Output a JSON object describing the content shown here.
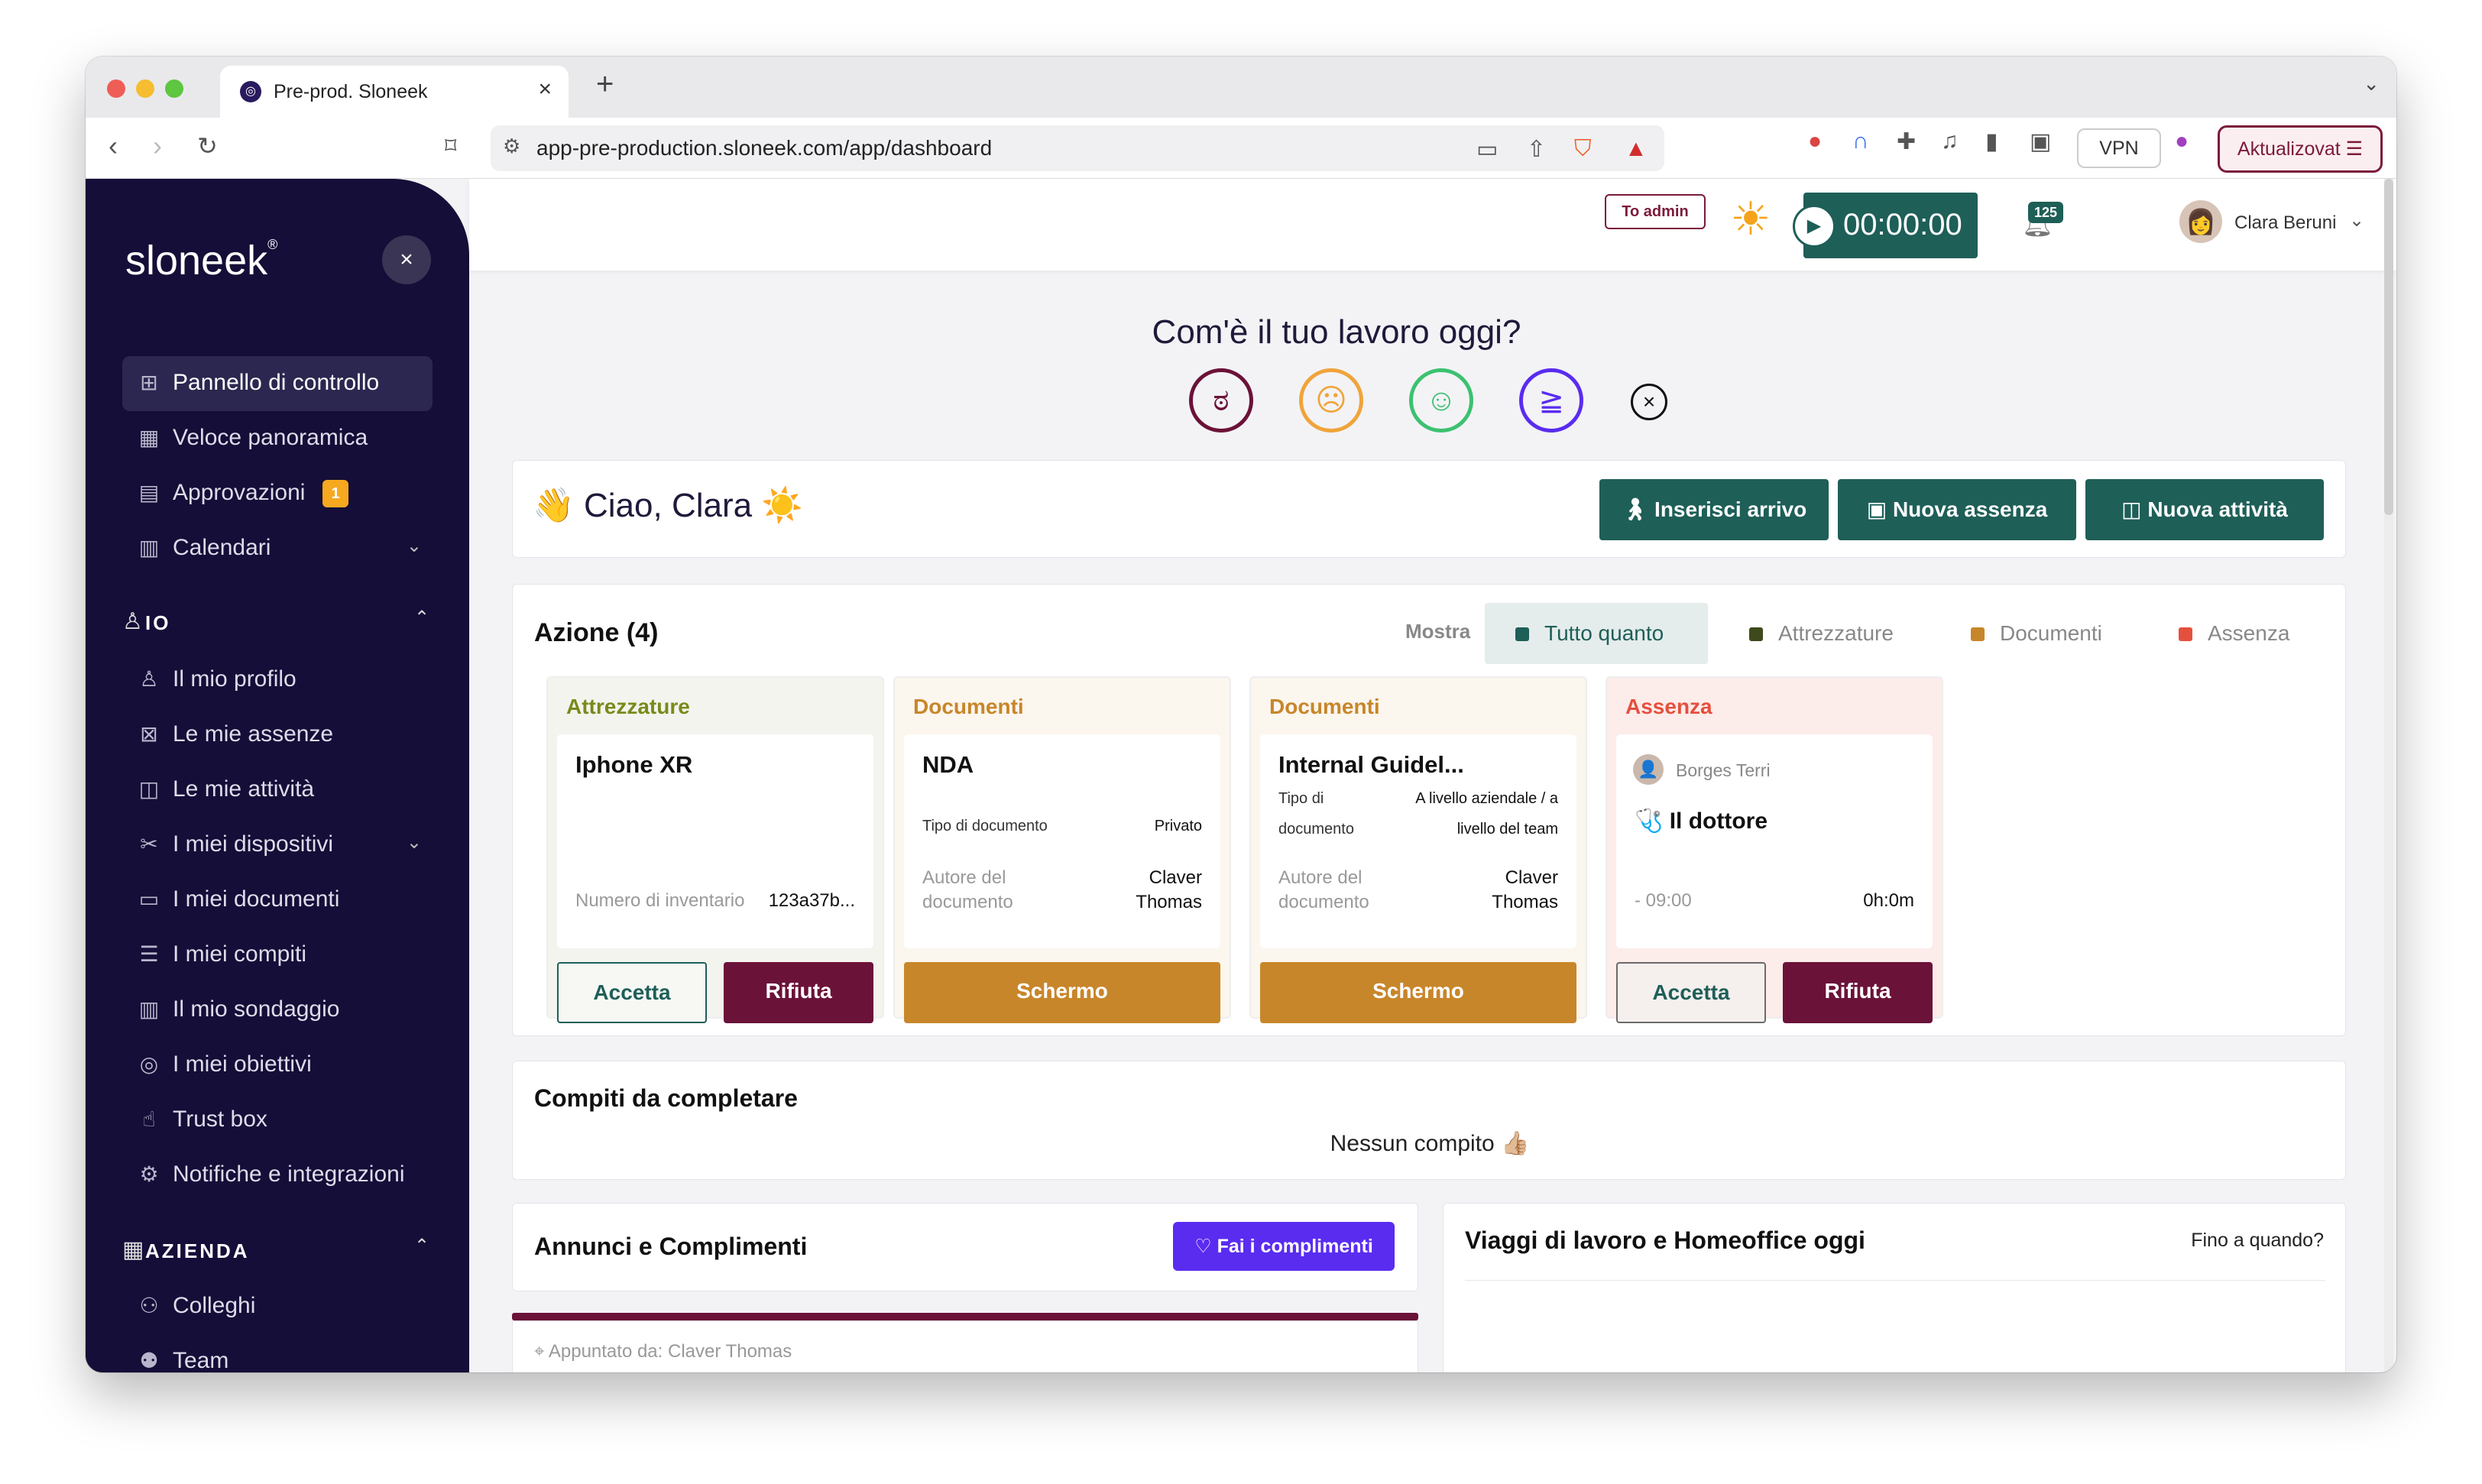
{
  "browser": {
    "tab_title": "Pre-prod. Sloneek",
    "url": "app-pre-production.sloneek.com/app/dashboard",
    "vpn_label": "VPN",
    "update_label": "Aktualizovat"
  },
  "sidebar": {
    "logo": "sloneek",
    "items_top": [
      {
        "label": "Pannello di controllo",
        "icon": "dashboard-icon",
        "active": true
      },
      {
        "label": "Veloce panoramica",
        "icon": "grid-icon"
      },
      {
        "label": "Approvazioni",
        "icon": "clipboard-icon",
        "badge": "1"
      },
      {
        "label": "Calendari",
        "icon": "calendar-icon",
        "chevron": true
      }
    ],
    "section_io": "IO",
    "items_io": [
      {
        "label": "Il mio profilo",
        "icon": "user-icon"
      },
      {
        "label": "Le mie assenze",
        "icon": "calendar-x-icon"
      },
      {
        "label": "Le mie attività",
        "icon": "book-icon"
      },
      {
        "label": "I miei dispositivi",
        "icon": "tools-icon",
        "chevron": true
      },
      {
        "label": "I miei documenti",
        "icon": "folder-icon"
      },
      {
        "label": "I miei compiti",
        "icon": "checklist-icon"
      },
      {
        "label": "Il mio sondaggio",
        "icon": "survey-icon"
      },
      {
        "label": "I miei obiettivi",
        "icon": "target-icon"
      },
      {
        "label": "Trust box",
        "icon": "hand-icon"
      },
      {
        "label": "Notifiche e integrazioni",
        "icon": "gear-icon"
      }
    ],
    "section_company": "AZIENDA",
    "items_company": [
      {
        "label": "Colleghi",
        "icon": "people-icon"
      },
      {
        "label": "Team",
        "icon": "team-icon"
      }
    ]
  },
  "topbar": {
    "to_admin": "To admin",
    "timer": "00:00:00",
    "notifications": "125",
    "user_name": "Clara Beruni"
  },
  "mood": {
    "title": "Com'è il tuo lavoro oggi?"
  },
  "greeting": {
    "text": "👋 Ciao, Clara ☀️",
    "buttons": [
      "Inserisci arrivo",
      "Nuova assenza",
      "Nuova attività"
    ]
  },
  "actions": {
    "title": "Azione (4)",
    "show_label": "Mostra",
    "filters": [
      {
        "label": "Tutto quanto",
        "color": "#1e5f58",
        "active": true
      },
      {
        "label": "Attrezzature",
        "color": "#3e4a1c"
      },
      {
        "label": "Documenti",
        "color": "#c8862a"
      },
      {
        "label": "Assenza",
        "color": "#e5503e"
      }
    ],
    "cards": [
      {
        "category": "Attrezzature",
        "name": "Iphone XR",
        "rows": [
          {
            "label": "Numero di inventario",
            "value": "123a37b..."
          }
        ],
        "accept": "Accetta",
        "reject": "Rifiuta"
      },
      {
        "category": "Documenti",
        "name": "NDA",
        "rows": [
          {
            "label": "Tipo di documento",
            "value": "Privato"
          },
          {
            "label": "Autore del documento",
            "value": "Claver Thomas"
          }
        ],
        "button": "Schermo"
      },
      {
        "category": "Documenti",
        "name": "Internal Guidel...",
        "rows": [
          {
            "label": "Tipo di documento",
            "value": "A livello aziendale / a livello del team"
          },
          {
            "label": "Autore del documento",
            "value": "Claver Thomas"
          }
        ],
        "button": "Schermo"
      },
      {
        "category": "Assenza",
        "person": "Borges Terri",
        "name": "🩺 Il dottore",
        "time": "- 09:00",
        "duration": "0h:0m",
        "accept": "Accetta",
        "reject": "Rifiuta"
      }
    ]
  },
  "tasks": {
    "title": "Compiti da completare",
    "empty": "Nessun compito 👍🏼"
  },
  "announcements": {
    "title": "Annunci e Complimenti",
    "button": "Fai i complimenti",
    "pinned": "Appuntato da: Claver Thomas"
  },
  "trips": {
    "title": "Viaggi di lavoro e Homeoffice oggi",
    "link": "Fino a quando?"
  }
}
